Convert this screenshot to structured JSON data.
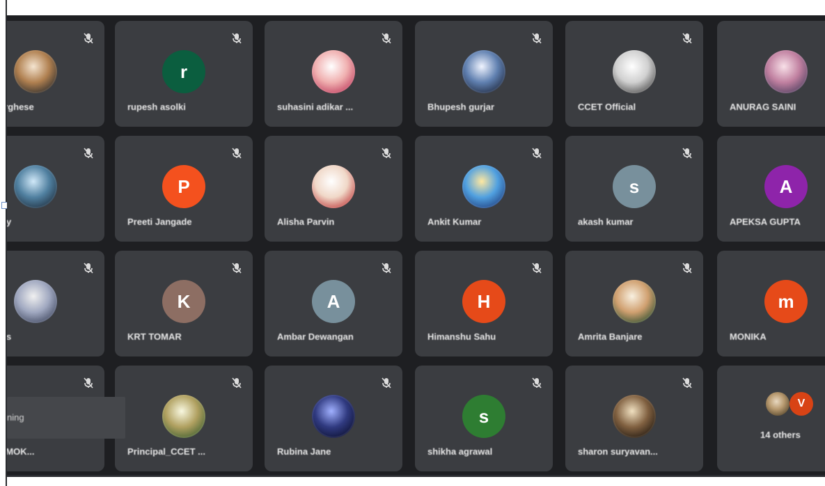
{
  "participants": [
    {
      "name": "PV Varghese",
      "avatar": {
        "type": "photo",
        "colors": [
          "#f4e4d0",
          "#b08050",
          "#2c2c2c"
        ]
      }
    },
    {
      "name": "rupesh asolki",
      "avatar": {
        "type": "initial",
        "letter": "r",
        "bg": "#0b5e3f"
      }
    },
    {
      "name": "suhasini adikar ...",
      "avatar": {
        "type": "photo",
        "colors": [
          "#ffffff",
          "#f0b0b0",
          "#c04060"
        ]
      }
    },
    {
      "name": "Bhupesh gurjar",
      "avatar": {
        "type": "photo",
        "colors": [
          "#f0f4ff",
          "#6080b0",
          "#202a40"
        ]
      }
    },
    {
      "name": "CCET Official",
      "avatar": {
        "type": "photo",
        "colors": [
          "#ffffff",
          "#d0d0d0",
          "#505050"
        ]
      }
    },
    {
      "name": "ANURAG SAINI",
      "avatar": {
        "type": "photo",
        "colors": [
          "#f8e0e8",
          "#c080a0",
          "#504060"
        ]
      }
    },
    {
      "name": "Pandey",
      "avatar": {
        "type": "photo",
        "colors": [
          "#d0e8f8",
          "#5080a0",
          "#203040"
        ]
      }
    },
    {
      "name": "Preeti Jangade",
      "avatar": {
        "type": "initial",
        "letter": "P",
        "bg": "#f4511e"
      }
    },
    {
      "name": "Alisha Parvin",
      "avatar": {
        "type": "photo",
        "colors": [
          "#ffffff",
          "#f0d8c8",
          "#c04040"
        ]
      }
    },
    {
      "name": "Ankit Kumar",
      "avatar": {
        "type": "photo",
        "colors": [
          "#ffe8a0",
          "#50a0e0",
          "#204080"
        ]
      }
    },
    {
      "name": "akash kumar",
      "avatar": {
        "type": "initial",
        "letter": "s",
        "bg": "#78909c"
      }
    },
    {
      "name": "APEKSA GUPTA",
      "avatar": {
        "type": "initial",
        "letter": "A",
        "bg": "#8e24aa"
      }
    },
    {
      "name": "Devdas",
      "avatar": {
        "type": "photo",
        "colors": [
          "#f0f0f0",
          "#a0a8c0",
          "#404860"
        ]
      }
    },
    {
      "name": "KRT TOMAR",
      "avatar": {
        "type": "initial",
        "letter": "K",
        "bg": "#8d6e63"
      }
    },
    {
      "name": "Ambar Dewangan",
      "avatar": {
        "type": "initial",
        "letter": "A",
        "bg": "#78909c"
      }
    },
    {
      "name": "Himanshu Sahu",
      "avatar": {
        "type": "initial",
        "letter": "H",
        "bg": "#e64a19"
      }
    },
    {
      "name": "Amrita Banjare",
      "avatar": {
        "type": "photo",
        "colors": [
          "#f8f0e0",
          "#d0a070",
          "#305030"
        ]
      }
    },
    {
      "name": "MONIKA",
      "avatar": {
        "type": "initial",
        "letter": "m",
        "bg": "#e64a19"
      }
    },
    {
      "name": "ifabhi MOK...",
      "avatar": {
        "type": "none"
      }
    },
    {
      "name": "Principal_CCET ...",
      "avatar": {
        "type": "photo",
        "colors": [
          "#f8f8e0",
          "#b0a060",
          "#406030"
        ]
      }
    },
    {
      "name": "Rubina Jane",
      "avatar": {
        "type": "photo",
        "colors": [
          "#a0b0ff",
          "#303a80",
          "#0c1030"
        ]
      }
    },
    {
      "name": "shikha agrawal",
      "avatar": {
        "type": "initial",
        "letter": "s",
        "bg": "#2e7d32"
      }
    },
    {
      "name": "sharon suryavan...",
      "avatar": {
        "type": "photo",
        "colors": [
          "#f0e0c0",
          "#806040",
          "#201810"
        ]
      }
    },
    {
      "name": "14 others",
      "avatar": {
        "type": "group",
        "letter": "V"
      }
    }
  ],
  "hover_overlay_text": "ning",
  "icons": {
    "mic": "mic-off-icon"
  }
}
